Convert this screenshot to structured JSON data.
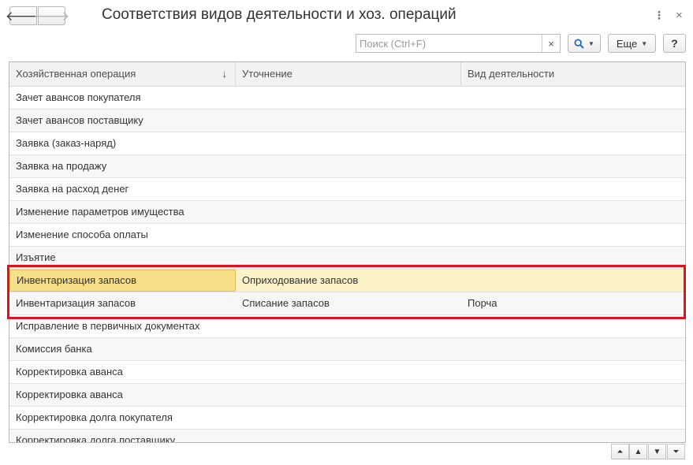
{
  "window": {
    "title": "Соответствия видов деятельности и хоз. операций",
    "back_icon": "🡐",
    "forward_icon": "🡒",
    "menu_icon": "⋮",
    "close_icon": "×"
  },
  "toolbar": {
    "search_placeholder": "Поиск (Ctrl+F)",
    "search_clear": "×",
    "search_button_icon": "🔍",
    "more_label": "Еще",
    "help_label": "?"
  },
  "table": {
    "columns": [
      "Хозяйственная операция",
      "Уточнение",
      "Вид деятельности"
    ],
    "sort_indicator": "↓",
    "rows": [
      [
        "Зачет авансов покупателя",
        "",
        ""
      ],
      [
        "Зачет авансов поставщику",
        "",
        ""
      ],
      [
        "Заявка (заказ-наряд)",
        "",
        ""
      ],
      [
        "Заявка на продажу",
        "",
        ""
      ],
      [
        "Заявка на расход денег",
        "",
        ""
      ],
      [
        "Изменение параметров имущества",
        "",
        ""
      ],
      [
        "Изменение способа оплаты",
        "",
        ""
      ],
      [
        "Изъятие",
        "",
        ""
      ],
      [
        "Инвентаризация запасов",
        "Оприходование запасов",
        ""
      ],
      [
        "Инвентаризация запасов",
        "Списание запасов",
        "Порча"
      ],
      [
        "Исправление в первичных документах",
        "",
        ""
      ],
      [
        "Комиссия банка",
        "",
        ""
      ],
      [
        "Корректировка аванса",
        "",
        ""
      ],
      [
        "Корректировка аванса",
        "",
        ""
      ],
      [
        "Корректировка долга покупателя",
        "",
        ""
      ],
      [
        "Корректировка долга поставщику",
        "",
        ""
      ]
    ]
  },
  "pager": {
    "top": "⏶",
    "up": "▲",
    "down": "▼",
    "bottom": "⏷"
  },
  "colors": {
    "selected_row": "#fbf2c7",
    "selected_cell": "#f7df8a",
    "highlight_frame": "#e0101e"
  }
}
